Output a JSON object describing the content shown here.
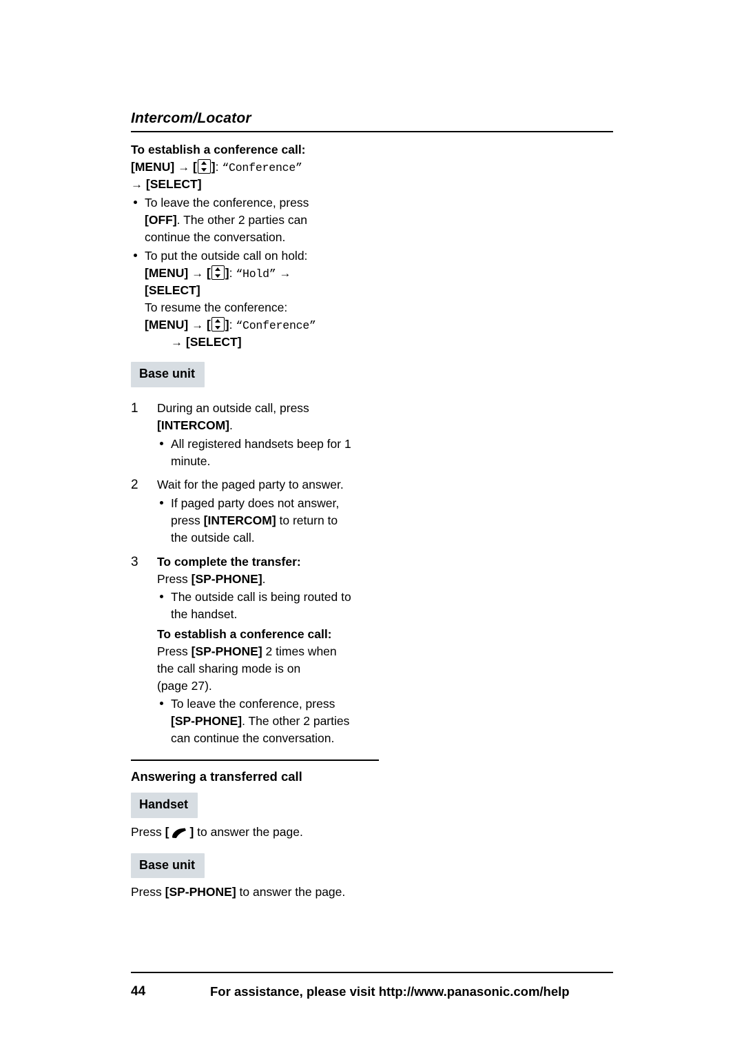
{
  "header": {
    "title": "Intercom/Locator"
  },
  "content": {
    "conference_heading": "To establish a conference call:",
    "menu_key": "MENU",
    "select_key": "SELECT",
    "conference_label": "“Conference”",
    "hold_label": "“Hold”",
    "off_key": "OFF",
    "intercom_key": "INTERCOM",
    "spphone_key": "SP-PHONE",
    "bullet_leave_conf_1a": "To leave the conference, press",
    "bullet_leave_conf_1b": ". The other 2 parties can",
    "bullet_leave_conf_1c": "continue the conversation.",
    "bullet_hold": "To put the outside call on hold:",
    "resume_line": "To resume the conference:",
    "base_unit_label": "Base unit",
    "handset_label": "Handset",
    "step1_text_a": "During an outside call, press",
    "step1_text_b": ".",
    "step1_bullet_a": "All registered handsets beep for 1",
    "step1_bullet_b": "minute.",
    "step2_text": "Wait for the paged party to answer.",
    "step2_bullet_a": "If paged party does not answer,",
    "step2_bullet_b1": "press ",
    "step2_bullet_b2": " to return to",
    "step2_bullet_c": "the outside call.",
    "step3_heading": "To complete the transfer:",
    "step3_press": "Press ",
    "step3_press_end": ".",
    "step3_bullet_a": "The outside call is being routed to",
    "step3_bullet_b": "the handset.",
    "step3_conf_heading": "To establish a conference call:",
    "step3_conf_line1a": "Press ",
    "step3_conf_line1b": " 2 times when",
    "step3_conf_line2": "the call sharing mode is on",
    "step3_conf_line3": "(page 27).",
    "step3_conf_bullet_a": "To leave the conference, press",
    "step3_conf_bullet_b": ". The other 2 parties",
    "step3_conf_bullet_c": "can continue the conversation.",
    "answering_heading": "Answering a transferred call",
    "handset_press_a": "Press ",
    "handset_press_b": " to answer the page.",
    "base_press_a": "Press ",
    "base_press_b": " to answer the page.",
    "arrow": "→",
    "bracket_open": "[",
    "bracket_close": "]"
  },
  "footer": {
    "page_number": "44",
    "text": "For assistance, please visit http://www.panasonic.com/help"
  },
  "icons": {
    "nav_key": "up-down-nav-key-icon",
    "talk_key": "handset-talk-icon"
  },
  "colors": {
    "unit_box_bg": "#d7dde2",
    "text": "#000000",
    "page_bg": "#ffffff"
  }
}
